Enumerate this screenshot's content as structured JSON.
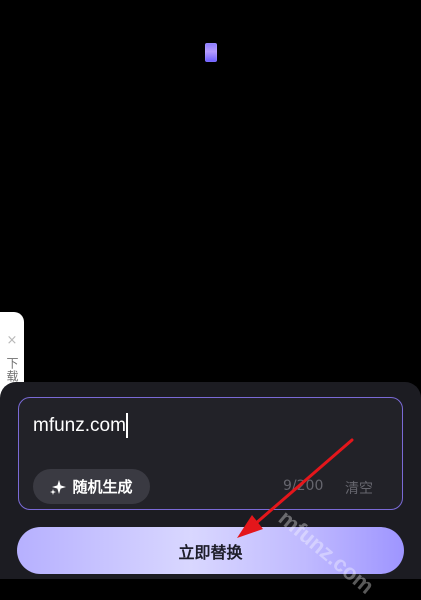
{
  "side_tab": {
    "close_glyph": "×",
    "label": "下载完成"
  },
  "input": {
    "value": "mfunz.com"
  },
  "random_button": {
    "label": "随机生成",
    "icon": "sparkle-icon"
  },
  "counter": "9/200",
  "clear_label": "清空",
  "confirm_button": {
    "label": "立即替换"
  },
  "watermark": "mfunz.com",
  "colors": {
    "accent": "#7a6ad6",
    "arrow": "#e4161b",
    "button_gradient_end": "#9e95ff"
  }
}
